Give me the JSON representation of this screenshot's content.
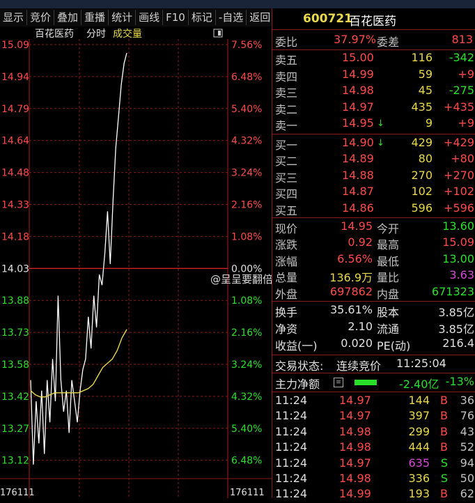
{
  "toolbar": {
    "buttons": [
      "显示",
      "竞价",
      "叠加",
      "重播",
      "统计",
      "画线",
      "F10",
      "标记",
      "-自选",
      "返回"
    ]
  },
  "chart": {
    "stock_name": "百花医药",
    "mode_label": "分时",
    "volume_label": "成交量",
    "price_ticks": [
      "15.09",
      "14.94",
      "14.79",
      "14.64",
      "14.48",
      "14.33",
      "14.18",
      "14.03",
      "13.88",
      "13.73",
      "13.58",
      "13.42",
      "13.27",
      "13.12"
    ],
    "pct_ticks": [
      "7.56%",
      "6.48%",
      "5.40%",
      "4.32%",
      "3.24%",
      "2.16%",
      "1.08%",
      "0.00%",
      "1.08%",
      "2.16%",
      "3.24%",
      "4.32%",
      "5.40%",
      "6.48%"
    ],
    "bottom_left": "176111",
    "bottom_right": "176111",
    "watermark": "@呈呈要翻倍"
  },
  "chart_data": {
    "type": "line",
    "prev_close": 14.03,
    "ylim": [
      13.05,
      15.09
    ],
    "series": [
      {
        "color": "#ffffff",
        "values": [
          13.5,
          13.1,
          13.4,
          13.2,
          13.45,
          13.15,
          13.5,
          13.3,
          13.6,
          13.4,
          13.9,
          13.5,
          13.35,
          13.45,
          13.25,
          13.5,
          13.4,
          13.3,
          13.45,
          13.55,
          13.6,
          13.8,
          13.65,
          13.9,
          13.75,
          14.0,
          13.95,
          14.1,
          14.3,
          14.05,
          14.35,
          14.6,
          14.75,
          14.9,
          15.0,
          15.05
        ]
      },
      {
        "color": "#e8d84a",
        "values": [
          13.45,
          13.43,
          13.42,
          13.42,
          13.43,
          13.44,
          13.44,
          13.44,
          13.44,
          13.44,
          13.44,
          13.45,
          13.46,
          13.48,
          13.52,
          13.56,
          13.58,
          13.6,
          13.64,
          13.7,
          13.74
        ]
      }
    ]
  },
  "stock": {
    "code": "600721",
    "name": "百花医药"
  },
  "summary": {
    "wb_label": "委比",
    "wb_value": "37.97%",
    "wc_label": "委差",
    "wc_value": "813"
  },
  "sell": [
    {
      "label": "卖五",
      "price": "15.00",
      "vol": "116",
      "chg": "-342",
      "chg_color": "green",
      "arrow": ""
    },
    {
      "label": "卖四",
      "price": "14.99",
      "vol": "59",
      "chg": "+9",
      "chg_color": "red",
      "arrow": ""
    },
    {
      "label": "卖三",
      "price": "14.98",
      "vol": "45",
      "chg": "-275",
      "chg_color": "green",
      "arrow": ""
    },
    {
      "label": "卖二",
      "price": "14.97",
      "vol": "435",
      "chg": "+435",
      "chg_color": "red",
      "arrow": ""
    },
    {
      "label": "卖一",
      "price": "14.95",
      "vol": "9",
      "chg": "+9",
      "chg_color": "red",
      "arrow": "↓"
    }
  ],
  "buy": [
    {
      "label": "买一",
      "price": "14.90",
      "vol": "429",
      "chg": "+429",
      "chg_color": "red",
      "arrow": "↓"
    },
    {
      "label": "买二",
      "price": "14.89",
      "vol": "80",
      "chg": "+80",
      "chg_color": "red",
      "arrow": ""
    },
    {
      "label": "买三",
      "price": "14.88",
      "vol": "270",
      "chg": "+270",
      "chg_color": "red",
      "arrow": ""
    },
    {
      "label": "买四",
      "price": "14.87",
      "vol": "102",
      "chg": "+102",
      "chg_color": "red",
      "arrow": ""
    },
    {
      "label": "买五",
      "price": "14.86",
      "vol": "596",
      "chg": "+596",
      "chg_color": "red",
      "arrow": ""
    }
  ],
  "quote": [
    {
      "l1": "现价",
      "v1": "14.95",
      "c1": "red",
      "l2": "今开",
      "v2": "13.60",
      "c2": "green"
    },
    {
      "l1": "涨跌",
      "v1": "0.92",
      "c1": "red",
      "l2": "最高",
      "v2": "15.09",
      "c2": "red"
    },
    {
      "l1": "涨幅",
      "v1": "6.56%",
      "c1": "red",
      "l2": "最低",
      "v2": "13.00",
      "c2": "green"
    },
    {
      "l1": "总量",
      "v1": "136.9万",
      "c1": "yellow",
      "l2": "量比",
      "v2": "3.63",
      "c2": "purple"
    },
    {
      "l1": "外盘",
      "v1": "697862",
      "c1": "red",
      "l2": "内盘",
      "v2": "671323",
      "c2": "green"
    }
  ],
  "fundamentals": [
    {
      "l1": "换手",
      "v1": "35.61%",
      "l2": "股本",
      "v2": "3.85亿"
    },
    {
      "l1": "净资",
      "v1": "2.10",
      "l2": "流通",
      "v2": "3.85亿"
    },
    {
      "l1": "收益(一)",
      "v1": "0.020",
      "l2": "PE(动)",
      "v2": "216.4"
    }
  ],
  "status": {
    "label": "交易状态:",
    "value": "连续竞价",
    "time": "11:25:04"
  },
  "flow": {
    "label": "主力净额",
    "value": "-2.40亿",
    "pct": "-13%"
  },
  "ticks": [
    {
      "time": "11:24",
      "price": "14.97",
      "vol": "144",
      "vol_color": "yellow",
      "side": "B",
      "side_color": "red",
      "n": "36"
    },
    {
      "time": "11:24",
      "price": "14.97",
      "vol": "397",
      "vol_color": "yellow",
      "side": "B",
      "side_color": "red",
      "n": "76"
    },
    {
      "time": "11:24",
      "price": "14.98",
      "vol": "299",
      "vol_color": "yellow",
      "side": "B",
      "side_color": "red",
      "n": "43"
    },
    {
      "time": "11:24",
      "price": "14.98",
      "vol": "444",
      "vol_color": "yellow",
      "side": "B",
      "side_color": "red",
      "n": "52"
    },
    {
      "time": "11:24",
      "price": "14.97",
      "vol": "635",
      "vol_color": "purple",
      "side": "S",
      "side_color": "green",
      "n": "94"
    },
    {
      "time": "11:24",
      "price": "14.98",
      "vol": "336",
      "vol_color": "yellow",
      "side": "S",
      "side_color": "green",
      "n": "50"
    },
    {
      "time": "11:24",
      "price": "14.99",
      "vol": "193",
      "vol_color": "yellow",
      "side": "B",
      "side_color": "red",
      "n": "62"
    }
  ]
}
